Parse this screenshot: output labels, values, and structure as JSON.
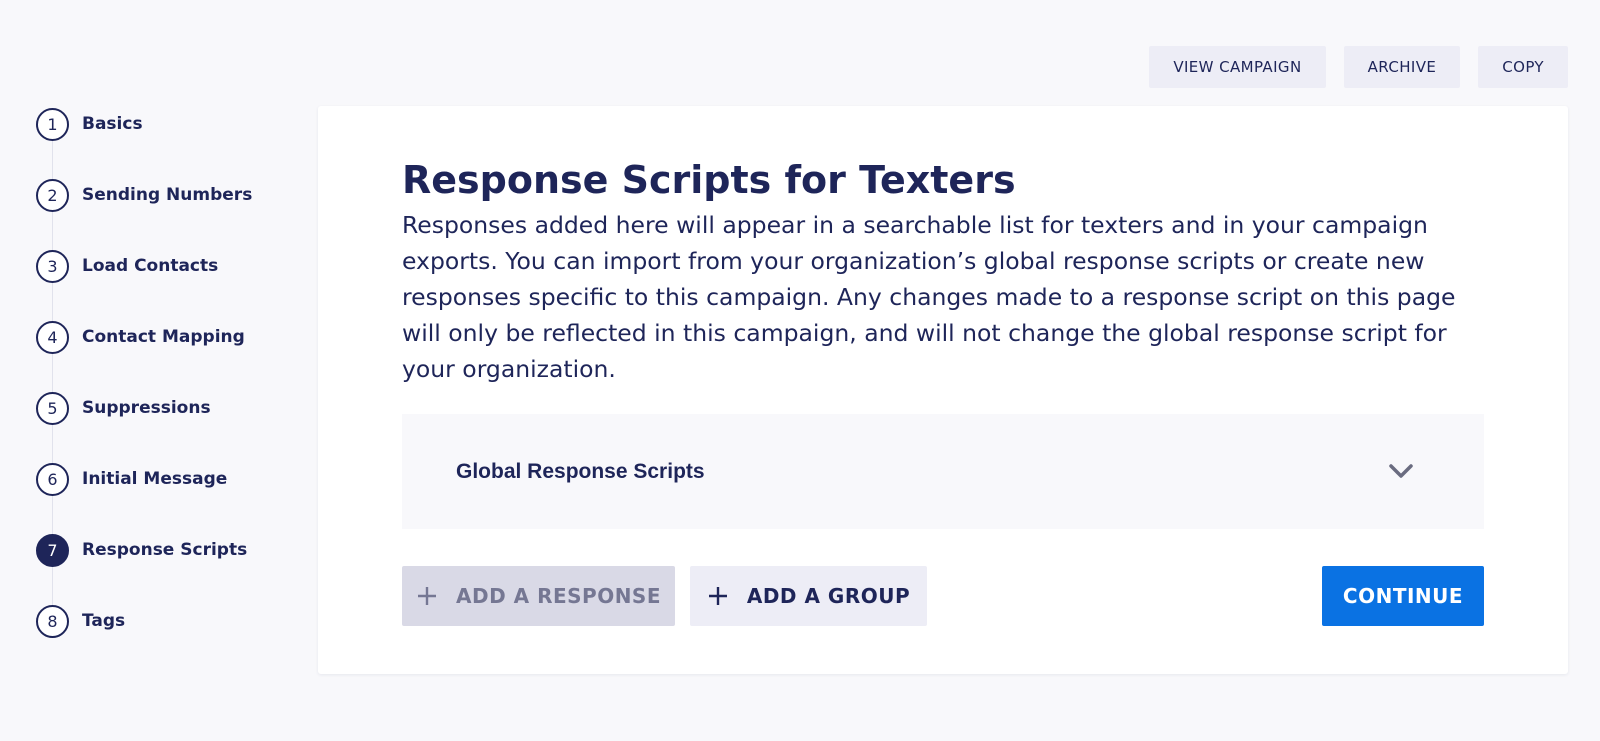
{
  "header": {
    "actions": [
      "VIEW CAMPAIGN",
      "ARCHIVE",
      "COPY"
    ]
  },
  "stepper": {
    "active_step": 7,
    "steps": [
      {
        "number": "1",
        "label": "Basics"
      },
      {
        "number": "2",
        "label": "Sending Numbers"
      },
      {
        "number": "3",
        "label": "Load Contacts"
      },
      {
        "number": "4",
        "label": "Contact Mapping"
      },
      {
        "number": "5",
        "label": "Suppressions"
      },
      {
        "number": "6",
        "label": "Initial Message"
      },
      {
        "number": "7",
        "label": "Response Scripts"
      },
      {
        "number": "8",
        "label": "Tags"
      }
    ]
  },
  "main": {
    "title": "Response Scripts for Texters",
    "description": "Responses added here will appear in a searchable list for texters and in your campaign exports. You can import from your organization’s global response scripts or create new responses specific to this campaign. Any changes made to a response script on this page will only be reflected in this campaign, and will not change the global response script for your organization.",
    "accordion": {
      "label": "Global Response Scripts",
      "icon": "chevron-down-icon"
    },
    "buttons": {
      "add_response": "ADD A RESPONSE",
      "add_group": "ADD A GROUP",
      "continue": "CONTINUE"
    }
  },
  "colors": {
    "primary_text": "#1e2559",
    "accent": "#0a72e3",
    "background": "#f8f8fb",
    "button_bg": "#ededf6",
    "disabled_bg": "#d9d9e6"
  }
}
